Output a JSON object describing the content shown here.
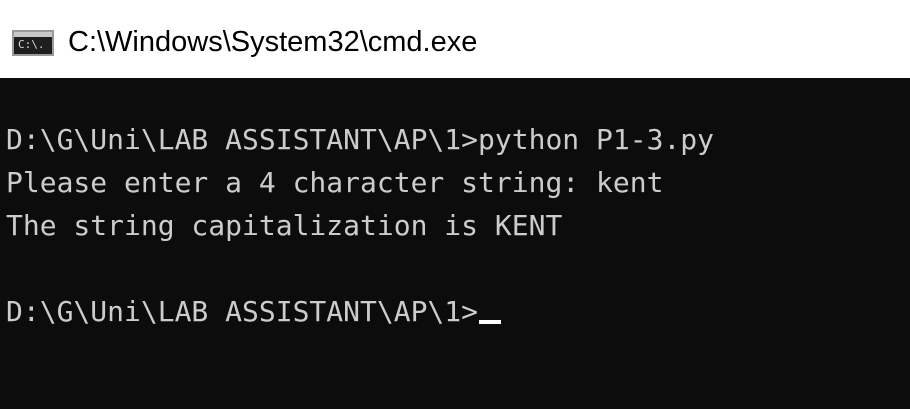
{
  "window": {
    "title": "C:\\Windows\\System32\\cmd.exe",
    "icon": "cmd-icon",
    "icon_text": "C:\\."
  },
  "console": {
    "lines": [
      "D:\\G\\Uni\\LAB ASSISTANT\\AP\\1>python P1-3.py",
      "Please enter a 4 character string: kent",
      "The string capitalization is KENT",
      "",
      "D:\\G\\Uni\\LAB ASSISTANT\\AP\\1>"
    ]
  },
  "colors": {
    "console_background": "#0c0c0c",
    "console_text": "#cccccc",
    "titlebar_background": "#ffffff",
    "cursor": "#ffffff"
  }
}
